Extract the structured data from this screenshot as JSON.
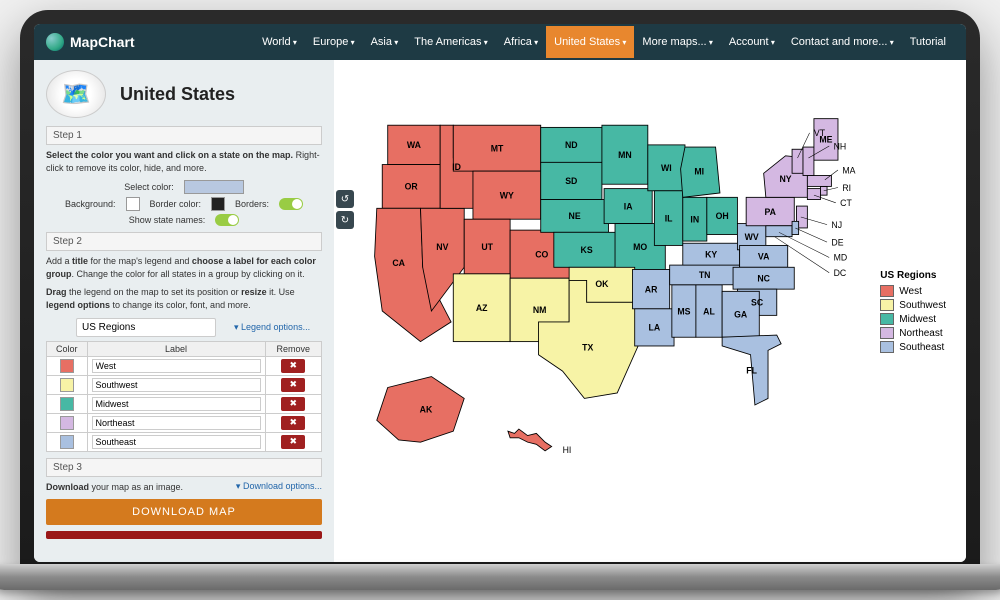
{
  "brand": "MapChart",
  "nav": [
    "World",
    "Europe",
    "Asia",
    "The Americas",
    "Africa",
    "United States",
    "More maps...",
    "Account",
    "Contact and more...",
    "Tutorial"
  ],
  "nav_active": 5,
  "title": "United States",
  "colors": {
    "west": "#e76f63",
    "southwest": "#f7f3a6",
    "midwest": "#47b8a4",
    "northeast": "#d4b8e2",
    "southeast": "#a9c0e0",
    "background": "#ffffff",
    "border": "#222222",
    "select": "#b8c8e0"
  },
  "step1": {
    "hdr": "Step 1",
    "text1": "Select the color you want and click on a state on the map.",
    "text2": " Right-click to remove its color, hide, and more.",
    "lbl_select": "Select color:",
    "lbl_bg": "Background:",
    "lbl_border": "Border color:",
    "lbl_borders": "Borders:",
    "lbl_names": "Show state names:"
  },
  "step2": {
    "hdr": "Step 2",
    "text1a": "Add a ",
    "text1b": "title",
    "text1c": " for the map's legend and ",
    "text1d": "choose a label for each color group",
    "text1e": ". Change the color for all states in a group by clicking on it.",
    "text2a": "Drag",
    "text2b": " the legend on the map to set its position or ",
    "text2c": "resize",
    "text2d": " it. Use ",
    "text2e": "legend options",
    "text2f": " to change its color, font, and more.",
    "title_value": "US Regions",
    "legend_link": "▾ Legend options...",
    "th_color": "Color",
    "th_label": "Label",
    "th_remove": "Remove",
    "rows": [
      {
        "c": "#e76f63",
        "l": "West"
      },
      {
        "c": "#f7f3a6",
        "l": "Southwest"
      },
      {
        "c": "#47b8a4",
        "l": "Midwest"
      },
      {
        "c": "#d4b8e2",
        "l": "Northeast"
      },
      {
        "c": "#a9c0e0",
        "l": "Southeast"
      }
    ]
  },
  "step3": {
    "hdr": "Step 3",
    "text1a": "Download",
    "text1b": " your map as an image.",
    "dl_link": "▾ Download options...",
    "btn": "DOWNLOAD MAP"
  },
  "legend": {
    "title": "US Regions",
    "items": [
      {
        "c": "#e76f63",
        "l": "West"
      },
      {
        "c": "#f7f3a6",
        "l": "Southwest"
      },
      {
        "c": "#47b8a4",
        "l": "Midwest"
      },
      {
        "c": "#d4b8e2",
        "l": "Northeast"
      },
      {
        "c": "#a9c0e0",
        "l": "Southeast"
      }
    ]
  },
  "states": {
    "west": [
      "WA",
      "OR",
      "CA",
      "NV",
      "ID",
      "MT",
      "WY",
      "UT",
      "CO",
      "AK",
      "HI"
    ],
    "southwest": [
      "AZ",
      "NM",
      "TX",
      "OK"
    ],
    "midwest": [
      "ND",
      "SD",
      "NE",
      "KS",
      "MN",
      "IA",
      "MO",
      "WI",
      "IL",
      "IN",
      "MI",
      "OH"
    ],
    "northeast": [
      "PA",
      "NY",
      "NJ",
      "CT",
      "RI",
      "MA",
      "VT",
      "NH",
      "ME"
    ],
    "southeast": [
      "WV",
      "VA",
      "KY",
      "TN",
      "NC",
      "SC",
      "GA",
      "FL",
      "AL",
      "MS",
      "LA",
      "AR",
      "MD",
      "DE",
      "DC"
    ]
  },
  "ext_labels": [
    "VT",
    "NH",
    "MA",
    "RI",
    "CT",
    "NJ",
    "DE",
    "MD",
    "DC"
  ]
}
